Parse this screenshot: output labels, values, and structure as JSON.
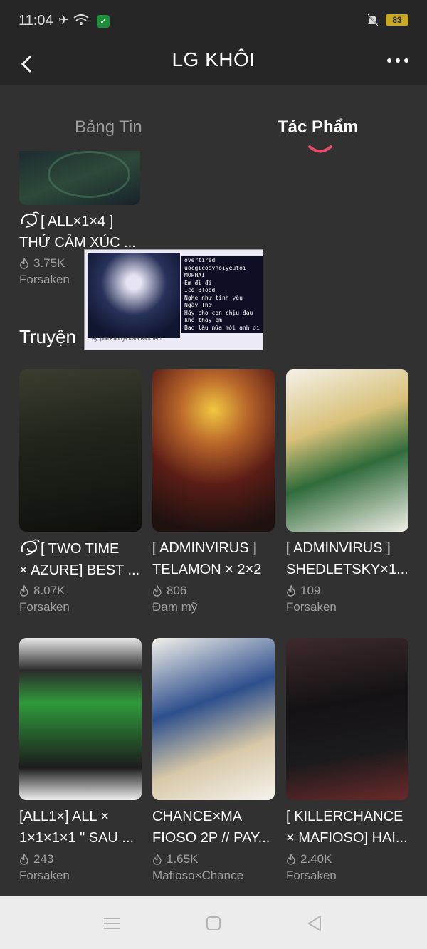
{
  "status": {
    "time": "11:04",
    "battery": "83"
  },
  "header": {
    "title": "LG KHÔI"
  },
  "tabs": [
    {
      "label": "Bảng Tin",
      "active": false
    },
    {
      "label": "Tác Phẩm",
      "active": true
    }
  ],
  "accent_color": "#e94b6a",
  "partial_card": {
    "title_line1": "[ ALL×1×4 ]",
    "title_line2": "THỨ CẢM XÚC ...",
    "views": "3.75K",
    "tag": "Forsaken"
  },
  "popup": {
    "lines": [
      "overtired",
      "uocgicoaynoiyeutoi",
      "MOPHAI",
      "Em đi đi",
      "Ice Blood",
      "Nghe như tình yêu",
      "Ngày Thơ",
      "Hãy cho con chịu đau",
      "khó thay em",
      "Bao lâu nữa mới anh ơi"
    ],
    "caption": "By: phu Khunga Kara Ba Kuerni"
  },
  "section_label": "Truyện",
  "cards": [
    {
      "title_line1": "[ TWO TIME",
      "title_line2": "× AZURE] BEST ...",
      "views": "8.07K",
      "tag": "Forsaken",
      "icon": true
    },
    {
      "title_line1": "[ ADMINVIRUS ]",
      "title_line2": "TELAMON × 2×2",
      "views": "806",
      "tag": "Đam mỹ",
      "icon": false
    },
    {
      "title_line1": "[ ADMINVIRUS ]",
      "title_line2": "SHEDLETSKY×1...",
      "views": "109",
      "tag": "Forsaken",
      "icon": false
    },
    {
      "title_line1": "[ALL1×] ALL ×",
      "title_line2": "1×1×1×1 \" SAU ...",
      "views": "243",
      "tag": "Forsaken",
      "icon": false
    },
    {
      "title_line1": "CHANCE×MA",
      "title_line2": "FIOSO 2P // PAY...",
      "views": "1.65K",
      "tag": "Mafioso×Chance",
      "icon": false
    },
    {
      "title_line1": "[ KILLERCHANCE",
      "title_line2": "× MAFIOSO] HAI...",
      "views": "2.40K",
      "tag": "Forsaken",
      "icon": false
    }
  ]
}
